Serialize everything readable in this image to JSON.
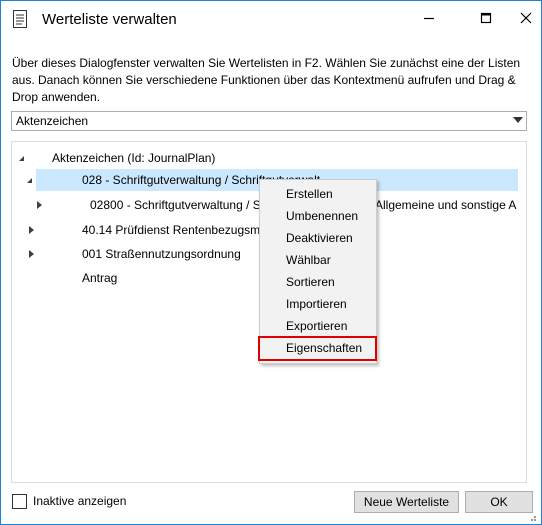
{
  "window": {
    "title": "Werteliste verwalten",
    "description": "Über dieses Dialogfenster verwalten Sie Wertelisten in F2. Wählen Sie zunächst eine der Listen aus. Danach können Sie verschiedene Funktionen über das Kontextmenü aufrufen und Drag & Drop anwenden."
  },
  "list_selector": {
    "value": "Aktenzeichen"
  },
  "tree": {
    "root": "Aktenzeichen (Id: JournalPlan)",
    "selected_item": "028 - Schriftgutverwaltung / Schriftgutverwalt",
    "child_item": "02800 - Schriftgutverwaltung / S",
    "child_item_tail": "Allgemeine und sonstige A",
    "item_2": "40.14 Prüfdienst Rentenbezugsmi",
    "item_3": "001 Straßennutzungsordnung",
    "item_4": "Antrag"
  },
  "context_menu": {
    "items": [
      "Erstellen",
      "Umbenennen",
      "Deaktivieren",
      "Wählbar",
      "Sortieren",
      "Importieren",
      "Exportieren",
      "Eigenschaften"
    ],
    "highlighted": "Eigenschaften",
    "highlight_color": "#e00000"
  },
  "footer": {
    "inactive_label": "Inaktive anzeigen",
    "inactive_checked": false,
    "new_list_button": "Neue Werteliste",
    "ok_button": "OK"
  },
  "colors": {
    "selection": "#cce8ff",
    "window_border": "#1883d7"
  }
}
